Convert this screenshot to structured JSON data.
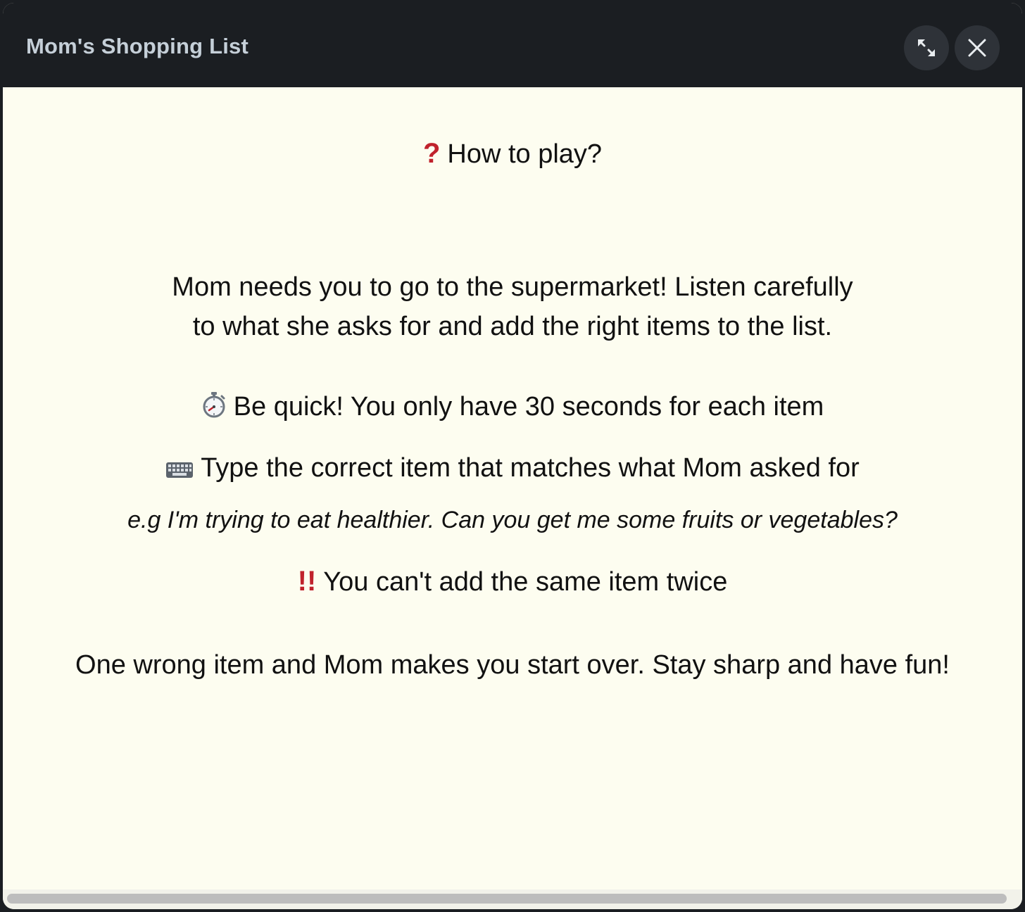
{
  "window": {
    "title": "Mom's Shopping List",
    "buttons": [
      {
        "name": "expand",
        "icon": "expand-arrows-icon"
      },
      {
        "name": "close",
        "icon": "close-x-icon"
      }
    ]
  },
  "instructions": {
    "heading_icon": "question-mark-icon",
    "heading": "How to play?",
    "intro_line1": "Mom needs you to go to the supermarket! Listen carefully",
    "intro_line2": "to what she asks for and add the right items to the list.",
    "rules": [
      {
        "icon": "stopwatch-icon",
        "text": "Be quick! You only have 30 seconds for each item"
      },
      {
        "icon": "keyboard-icon",
        "text": "Type the correct item that matches what Mom asked for"
      },
      {
        "icon": "double-exclamation-icon",
        "text": "You can't add the same item twice"
      }
    ],
    "example": "e.g I'm trying to eat healthier. Can you get me some fruits or vegetables?",
    "outro": "One wrong item and Mom makes you start over. Stay sharp and have fun!"
  },
  "colors": {
    "titlebar": "#1b1e22",
    "title_text": "#c5cfd8",
    "content_bg": "#fdfdf0",
    "accent_red": "#c0222c"
  }
}
